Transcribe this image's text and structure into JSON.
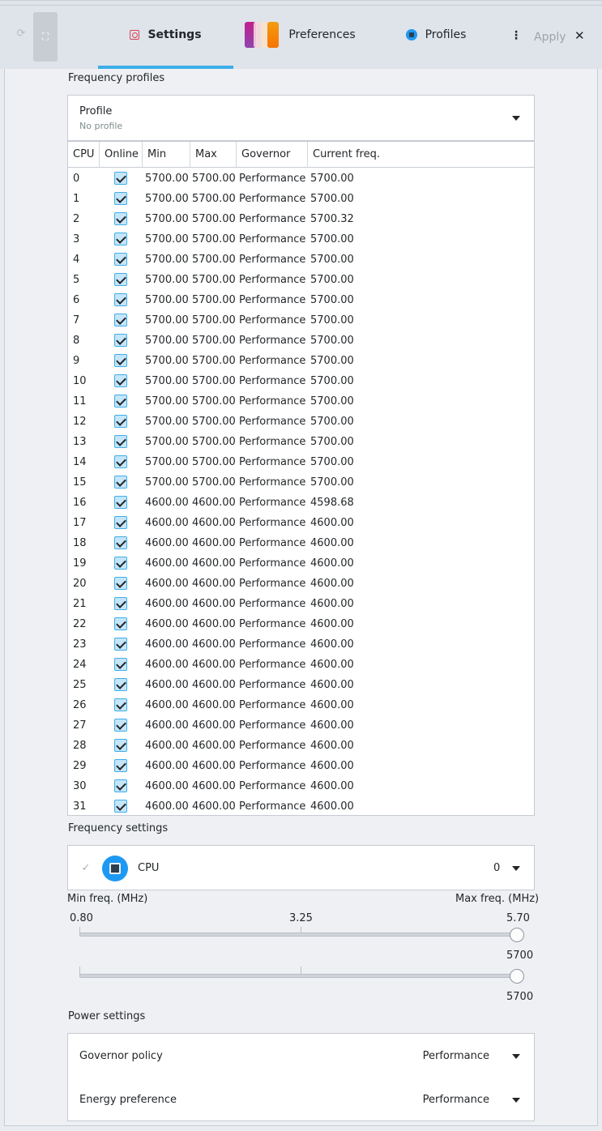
{
  "header": {
    "tabs": [
      {
        "label": "Settings",
        "icon": "settings-icon",
        "active": true
      },
      {
        "label": "Preferences",
        "icon": "preferences-icon",
        "active": false
      },
      {
        "label": "Profiles",
        "icon": "profiles-icon",
        "active": false
      }
    ],
    "apply_label": "Apply",
    "accent_color": "#3daee9"
  },
  "frequency_profiles": {
    "section_title": "Frequency profiles",
    "profile_label": "Profile",
    "profile_value": "No profile",
    "columns": [
      "CPU",
      "Online",
      "Min",
      "Max",
      "Governor",
      "Current freq."
    ],
    "rows": [
      {
        "cpu": "0",
        "online": true,
        "min": "5700.00",
        "max": "5700.00",
        "governor": "Performance",
        "current": "5700.00"
      },
      {
        "cpu": "1",
        "online": true,
        "min": "5700.00",
        "max": "5700.00",
        "governor": "Performance",
        "current": "5700.00"
      },
      {
        "cpu": "2",
        "online": true,
        "min": "5700.00",
        "max": "5700.00",
        "governor": "Performance",
        "current": "5700.32"
      },
      {
        "cpu": "3",
        "online": true,
        "min": "5700.00",
        "max": "5700.00",
        "governor": "Performance",
        "current": "5700.00"
      },
      {
        "cpu": "4",
        "online": true,
        "min": "5700.00",
        "max": "5700.00",
        "governor": "Performance",
        "current": "5700.00"
      },
      {
        "cpu": "5",
        "online": true,
        "min": "5700.00",
        "max": "5700.00",
        "governor": "Performance",
        "current": "5700.00"
      },
      {
        "cpu": "6",
        "online": true,
        "min": "5700.00",
        "max": "5700.00",
        "governor": "Performance",
        "current": "5700.00"
      },
      {
        "cpu": "7",
        "online": true,
        "min": "5700.00",
        "max": "5700.00",
        "governor": "Performance",
        "current": "5700.00"
      },
      {
        "cpu": "8",
        "online": true,
        "min": "5700.00",
        "max": "5700.00",
        "governor": "Performance",
        "current": "5700.00"
      },
      {
        "cpu": "9",
        "online": true,
        "min": "5700.00",
        "max": "5700.00",
        "governor": "Performance",
        "current": "5700.00"
      },
      {
        "cpu": "10",
        "online": true,
        "min": "5700.00",
        "max": "5700.00",
        "governor": "Performance",
        "current": "5700.00"
      },
      {
        "cpu": "11",
        "online": true,
        "min": "5700.00",
        "max": "5700.00",
        "governor": "Performance",
        "current": "5700.00"
      },
      {
        "cpu": "12",
        "online": true,
        "min": "5700.00",
        "max": "5700.00",
        "governor": "Performance",
        "current": "5700.00"
      },
      {
        "cpu": "13",
        "online": true,
        "min": "5700.00",
        "max": "5700.00",
        "governor": "Performance",
        "current": "5700.00"
      },
      {
        "cpu": "14",
        "online": true,
        "min": "5700.00",
        "max": "5700.00",
        "governor": "Performance",
        "current": "5700.00"
      },
      {
        "cpu": "15",
        "online": true,
        "min": "5700.00",
        "max": "5700.00",
        "governor": "Performance",
        "current": "5700.00"
      },
      {
        "cpu": "16",
        "online": true,
        "min": "4600.00",
        "max": "4600.00",
        "governor": "Performance",
        "current": "4598.68"
      },
      {
        "cpu": "17",
        "online": true,
        "min": "4600.00",
        "max": "4600.00",
        "governor": "Performance",
        "current": "4600.00"
      },
      {
        "cpu": "18",
        "online": true,
        "min": "4600.00",
        "max": "4600.00",
        "governor": "Performance",
        "current": "4600.00"
      },
      {
        "cpu": "19",
        "online": true,
        "min": "4600.00",
        "max": "4600.00",
        "governor": "Performance",
        "current": "4600.00"
      },
      {
        "cpu": "20",
        "online": true,
        "min": "4600.00",
        "max": "4600.00",
        "governor": "Performance",
        "current": "4600.00"
      },
      {
        "cpu": "21",
        "online": true,
        "min": "4600.00",
        "max": "4600.00",
        "governor": "Performance",
        "current": "4600.00"
      },
      {
        "cpu": "22",
        "online": true,
        "min": "4600.00",
        "max": "4600.00",
        "governor": "Performance",
        "current": "4600.00"
      },
      {
        "cpu": "23",
        "online": true,
        "min": "4600.00",
        "max": "4600.00",
        "governor": "Performance",
        "current": "4600.00"
      },
      {
        "cpu": "24",
        "online": true,
        "min": "4600.00",
        "max": "4600.00",
        "governor": "Performance",
        "current": "4600.00"
      },
      {
        "cpu": "25",
        "online": true,
        "min": "4600.00",
        "max": "4600.00",
        "governor": "Performance",
        "current": "4600.00"
      },
      {
        "cpu": "26",
        "online": true,
        "min": "4600.00",
        "max": "4600.00",
        "governor": "Performance",
        "current": "4600.00"
      },
      {
        "cpu": "27",
        "online": true,
        "min": "4600.00",
        "max": "4600.00",
        "governor": "Performance",
        "current": "4600.00"
      },
      {
        "cpu": "28",
        "online": true,
        "min": "4600.00",
        "max": "4600.00",
        "governor": "Performance",
        "current": "4600.00"
      },
      {
        "cpu": "29",
        "online": true,
        "min": "4600.00",
        "max": "4600.00",
        "governor": "Performance",
        "current": "4600.00"
      },
      {
        "cpu": "30",
        "online": true,
        "min": "4600.00",
        "max": "4600.00",
        "governor": "Performance",
        "current": "4600.00"
      },
      {
        "cpu": "31",
        "online": true,
        "min": "4600.00",
        "max": "4600.00",
        "governor": "Performance",
        "current": "4600.00"
      }
    ]
  },
  "frequency_settings": {
    "section_title": "Frequency settings",
    "cpu_label": "CPU",
    "cpu_value": "0",
    "min_label": "Min freq. (MHz)",
    "max_label": "Max freq. (MHz)",
    "scale_min": "0.80",
    "scale_mid": "3.25",
    "scale_max": "5.70",
    "min_slider_value": "5700",
    "max_slider_value": "5700",
    "min_slider_fraction": 1.0,
    "max_slider_fraction": 1.0
  },
  "power_settings": {
    "section_title": "Power settings",
    "governor_label": "Governor policy",
    "governor_value": "Performance",
    "energy_label": "Energy preference",
    "energy_value": "Performance"
  }
}
